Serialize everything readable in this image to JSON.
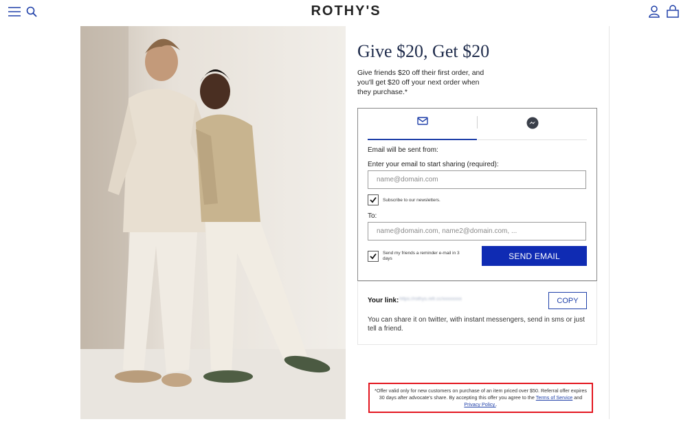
{
  "header": {
    "brand": "ROTHY'S",
    "icons": [
      "menu-icon",
      "search-icon",
      "account-icon",
      "cart-icon"
    ],
    "icon_color": "#1e3fa8"
  },
  "hero": {
    "description_icon": "photo"
  },
  "referral": {
    "headline": "Give $20, Get $20",
    "subtext": "Give friends $20 off their first order, and you'll get $20 off your next order when they purchase.*",
    "tabs": [
      {
        "icon": "mail-icon",
        "active": true
      },
      {
        "icon": "messenger-icon",
        "active": false
      }
    ],
    "email_sent_from_label": "Email will be sent from:",
    "your_email_label": "Enter your email to start sharing (required):",
    "your_email_placeholder": "name@domain.com",
    "subscribe_label": "Subscribe to our newsletters.",
    "subscribe_checked": true,
    "to_label": "To:",
    "to_placeholder": "name@domain.com, name2@domain.com, ...",
    "reminder_label": "Send my friends a reminder e-mail in 3 days",
    "reminder_checked": true,
    "send_button": "SEND EMAIL",
    "link_label": "Your link:",
    "link_value": "https://rothys.refr.cc/xxxxxxxx",
    "copy_button": "COPY",
    "share_hint": "You can share it on twitter, with instant messengers, send in sms or just tell a friend.",
    "disclaimer_text": "*Offer valid only for new customers on purchase of an item priced over $50. Referral offer expires 30 days after advocate's share. By accepting this offer you agree to the",
    "terms_link": "Terms of Service",
    "and_text": "and",
    "privacy_link": "Privacy Policy.",
    "disclaimer_end": ".",
    "accent_color": "#0f2bb3",
    "highlight_color": "#e3151e"
  }
}
